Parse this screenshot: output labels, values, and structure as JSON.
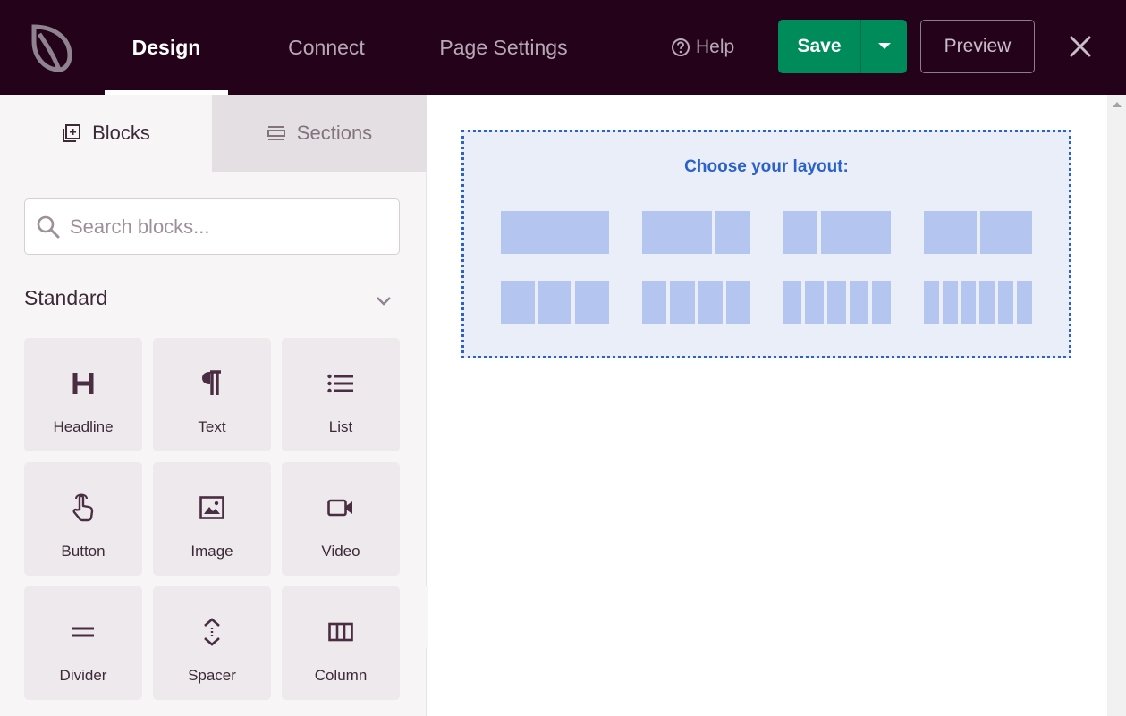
{
  "topbar": {
    "tabs": [
      {
        "label": "Design",
        "active": true
      },
      {
        "label": "Connect",
        "active": false
      },
      {
        "label": "Page Settings",
        "active": false
      }
    ],
    "help_label": "Help",
    "save_label": "Save",
    "preview_label": "Preview",
    "icons": {
      "logo": "leaf-logo",
      "help": "question-circle-icon",
      "caret": "caret-down-icon",
      "close": "close-icon"
    }
  },
  "sidebar": {
    "tabs": [
      {
        "label": "Blocks",
        "icon": "add-block-icon",
        "active": true
      },
      {
        "label": "Sections",
        "icon": "sections-icon",
        "active": false
      }
    ],
    "search_placeholder": "Search blocks...",
    "section_title": "Standard",
    "blocks": [
      {
        "label": "Headline",
        "icon": "headline-icon"
      },
      {
        "label": "Text",
        "icon": "paragraph-icon"
      },
      {
        "label": "List",
        "icon": "list-icon"
      },
      {
        "label": "Button",
        "icon": "pointer-hand-icon"
      },
      {
        "label": "Image",
        "icon": "image-icon"
      },
      {
        "label": "Video",
        "icon": "video-camera-icon"
      },
      {
        "label": "Divider",
        "icon": "divider-icon"
      },
      {
        "label": "Spacer",
        "icon": "spacer-icon"
      },
      {
        "label": "Column",
        "icon": "columns-icon"
      }
    ]
  },
  "canvas": {
    "layout_title": "Choose your layout:",
    "layouts": [
      {
        "name": "1-column",
        "columns": [
          1
        ]
      },
      {
        "name": "2-3-1-3",
        "columns": [
          2,
          1
        ]
      },
      {
        "name": "1-3-2-3",
        "columns": [
          1,
          2
        ]
      },
      {
        "name": "2-columns",
        "columns": [
          1,
          1
        ]
      },
      {
        "name": "3-columns",
        "columns": [
          1,
          1,
          1
        ]
      },
      {
        "name": "4-columns",
        "columns": [
          1,
          1,
          1,
          1
        ]
      },
      {
        "name": "5-columns",
        "columns": [
          1,
          1,
          1,
          1,
          1
        ]
      },
      {
        "name": "6-columns",
        "columns": [
          1,
          1,
          1,
          1,
          1,
          1
        ]
      }
    ]
  },
  "colors": {
    "topbar": "#23021a",
    "save": "#008b5a",
    "accent": "#2a62c9",
    "layout_col": "#b4c5f0"
  }
}
